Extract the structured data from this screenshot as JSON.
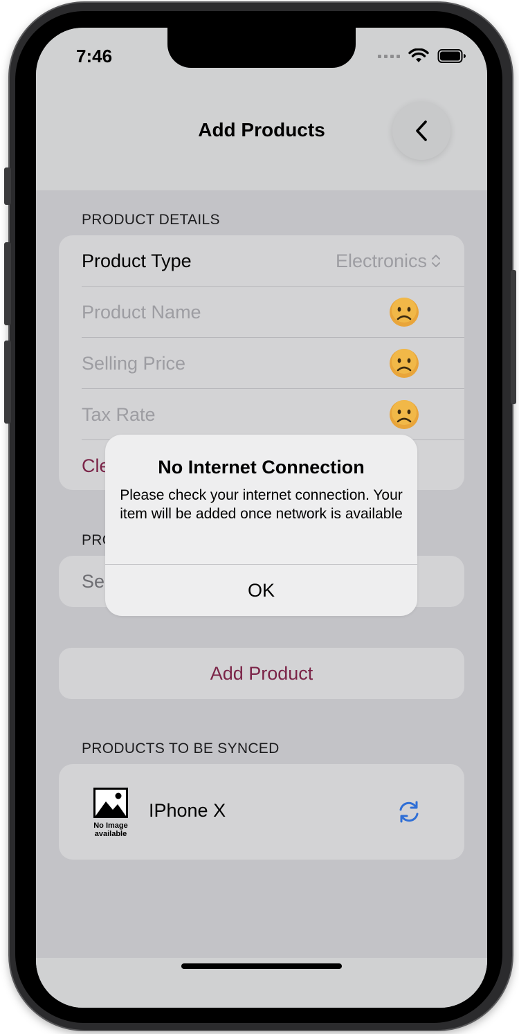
{
  "status_bar": {
    "time": "7:46"
  },
  "nav": {
    "title": "Add Products"
  },
  "product_details": {
    "header": "PRODUCT DETAILS",
    "product_type_label": "Product Type",
    "product_type_value": "Electronics",
    "product_name_placeholder": "Product Name",
    "selling_price_placeholder": "Selling Price",
    "tax_rate_placeholder": "Tax Rate",
    "clear_partial": "Cle"
  },
  "second_section": {
    "header_partial": "PRO",
    "field_partial": "Se"
  },
  "add_product_button": "Add Product",
  "sync_section": {
    "header": "PRODUCTS TO BE SYNCED",
    "items": [
      {
        "name": "IPhone X",
        "image_caption_line1": "No Image",
        "image_caption_line2": "available"
      }
    ]
  },
  "alert": {
    "title": "No Internet Connection",
    "message": "Please check your internet connection. Your item will be added once network is available",
    "ok_label": "OK"
  },
  "colors": {
    "tint": "#7b2448",
    "sync_icon": "#2f6fd6",
    "sad_face": "#e9a53a"
  }
}
